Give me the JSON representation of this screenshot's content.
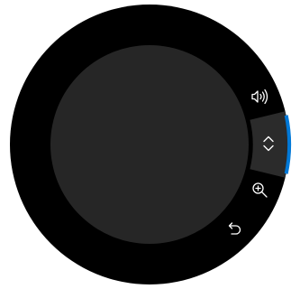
{
  "radial_menu": {
    "selected_item": "scroll",
    "items": [
      {
        "id": "volume",
        "icon": "volume-icon",
        "selected": false
      },
      {
        "id": "scroll",
        "icon": "scroll-up-down-icon",
        "selected": true
      },
      {
        "id": "zoom",
        "icon": "zoom-in-icon",
        "selected": false
      },
      {
        "id": "undo",
        "icon": "undo-icon",
        "selected": false
      }
    ],
    "colors": {
      "ring": "#000000",
      "hub": "#262626",
      "selected_segment": "#2b2b2b",
      "accent": "#0078d7",
      "icon": "#ffffff"
    }
  }
}
